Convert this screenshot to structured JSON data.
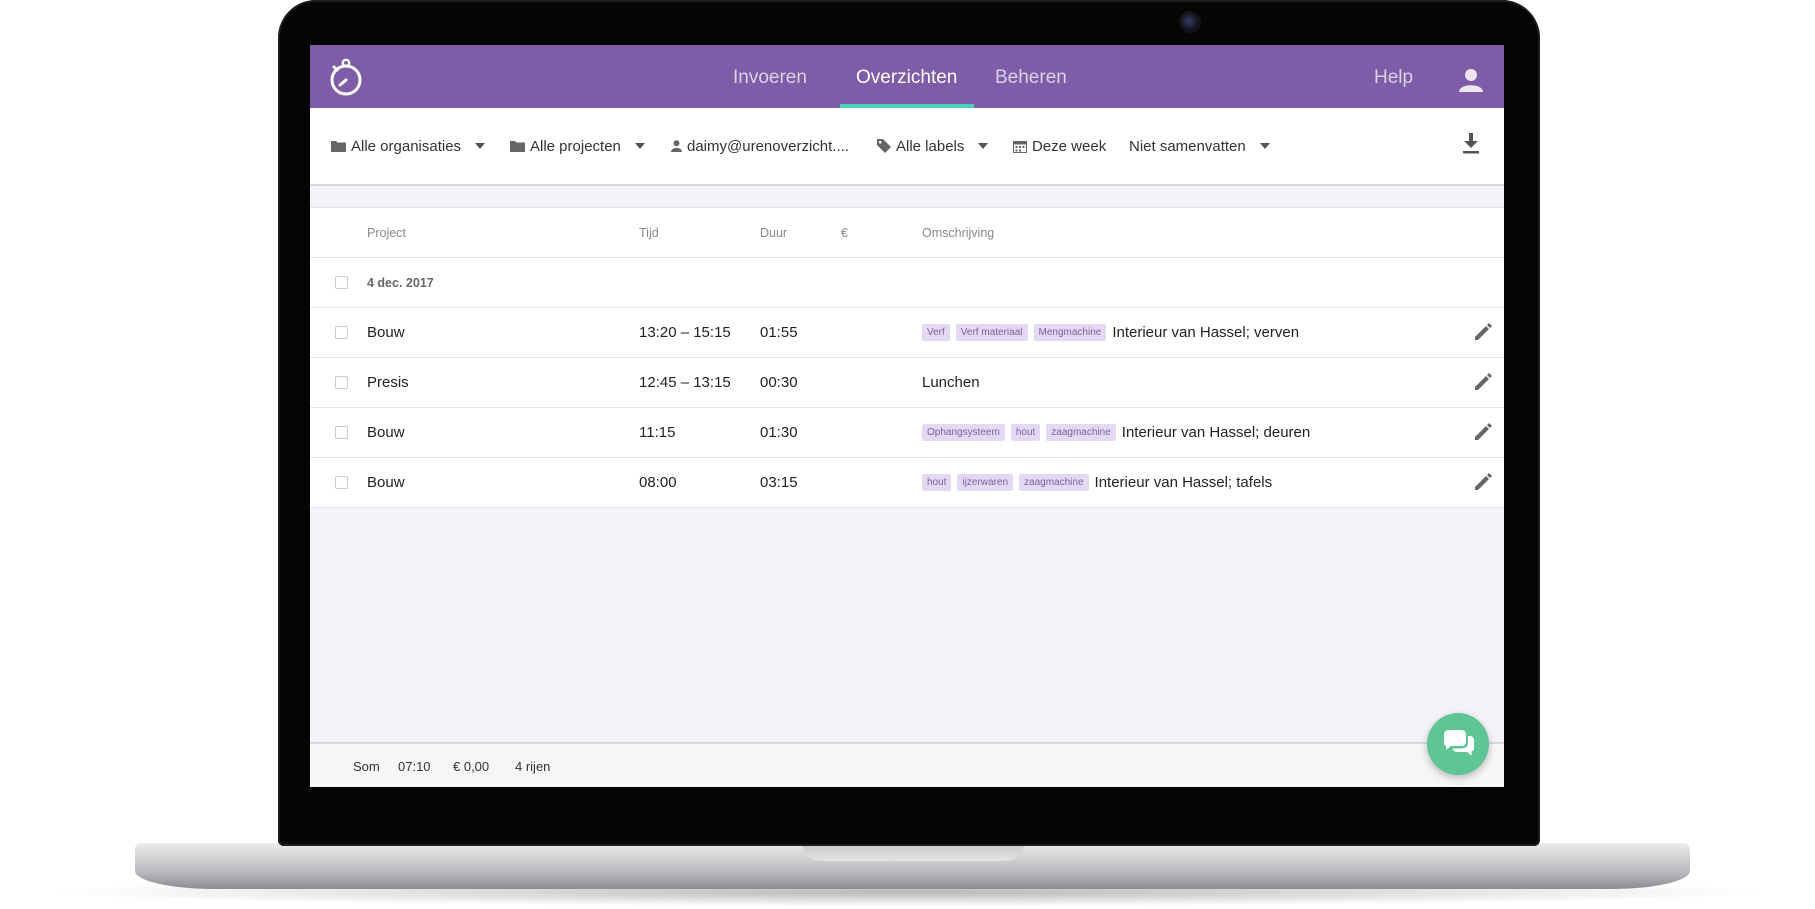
{
  "nav": {
    "items": [
      {
        "label": "Invoeren"
      },
      {
        "label": "Overzichten"
      },
      {
        "label": "Beheren"
      }
    ],
    "help": "Help"
  },
  "filters": {
    "organisations": "Alle organisaties",
    "projects": "Alle projecten",
    "user": "daimy@urenoverzicht....",
    "labels": "Alle labels",
    "period": "Deze week",
    "summarize": "Niet samenvatten"
  },
  "table": {
    "headers": {
      "project": "Project",
      "time": "Tijd",
      "duration": "Duur",
      "amount": "€",
      "description": "Omschrijving"
    },
    "group_date": "4 dec. 2017",
    "rows": [
      {
        "project": "Bouw",
        "time": "13:20 – 15:15",
        "duration": "01:55",
        "tags": [
          "Verf",
          "Verf materiaal",
          "Mengmachine"
        ],
        "description": "Interieur van Hassel; verven"
      },
      {
        "project": "Presis",
        "time": "12:45 – 13:15",
        "duration": "00:30",
        "tags": [],
        "description": "Lunchen"
      },
      {
        "project": "Bouw",
        "time": "11:15",
        "duration": "01:30",
        "tags": [
          "Ophangsysteem",
          "hout",
          "zaagmachine"
        ],
        "description": "Interieur van Hassel; deuren"
      },
      {
        "project": "Bouw",
        "time": "08:00",
        "duration": "03:15",
        "tags": [
          "hout",
          "ijzerwaren",
          "zaagmachine"
        ],
        "description": "Interieur van Hassel; tafels"
      }
    ]
  },
  "footer": {
    "sum_label": "Som",
    "total_time": "07:10",
    "total_amount": "€ 0,00",
    "row_count": "4 rijen"
  },
  "colors": {
    "brand": "#7e5ca8",
    "active_underline": "#4bd0b6",
    "tag_bg": "#e4d9f2",
    "tag_text": "#7b5fa3",
    "chat": "#5fc595"
  },
  "icons": [
    "stopwatch-logo-icon",
    "user-icon",
    "folder-icon",
    "person-icon",
    "tag-icon",
    "calendar-icon",
    "download-icon",
    "pencil-icon",
    "chat-bubbles-icon"
  ]
}
